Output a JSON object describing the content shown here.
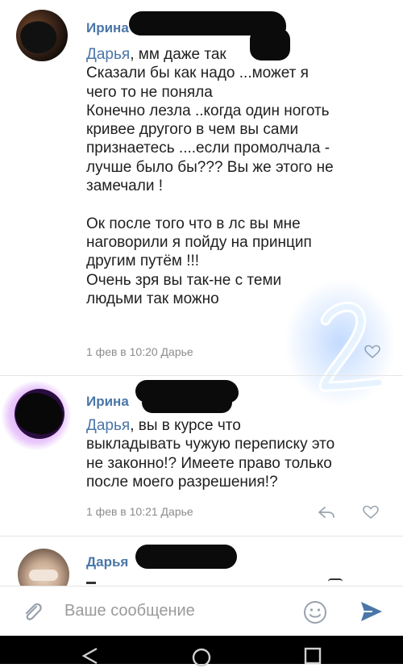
{
  "comments": [
    {
      "author": "Ирина",
      "mention": "Дарья",
      "lines": [
        ", мм даже так",
        "Сказали бы как надо ...может я",
        "чего то не поняла",
        "Конечно лезла ..когда один ноготь",
        "кривее другого в чем вы сами",
        "признаетесь ....если промолчала -",
        "лучше было бы??? Вы же этого не",
        "замечали !",
        "",
        "Ок после того что в лс вы мне",
        "наговорили я пойду на принцип",
        "другим путём !!!",
        "Очень зря вы так-не с теми",
        "людьми так можно"
      ],
      "meta": "1 фев в 10:20 Дарье"
    },
    {
      "author": "Ирина",
      "mention": "Дарья",
      "lines": [
        ", вы в курсе что",
        "выкладывать чужую переписку это",
        "не законно!? Имеете право только",
        "после моего разрешения!?"
      ],
      "meta": "1 фев в 10:21 Дарье"
    },
    {
      "author": "Дарья"
    }
  ],
  "composer": {
    "placeholder": "Ваше сообщение"
  },
  "icons": {
    "attach": "paperclip-icon",
    "emoji": "smiley-icon",
    "send": "send-icon",
    "like": "heart-icon",
    "reply": "reply-icon"
  },
  "colors": {
    "link": "#4a76a8",
    "meta": "#8c8c8c",
    "send": "#4a76a8"
  },
  "overlay_mark": "2"
}
